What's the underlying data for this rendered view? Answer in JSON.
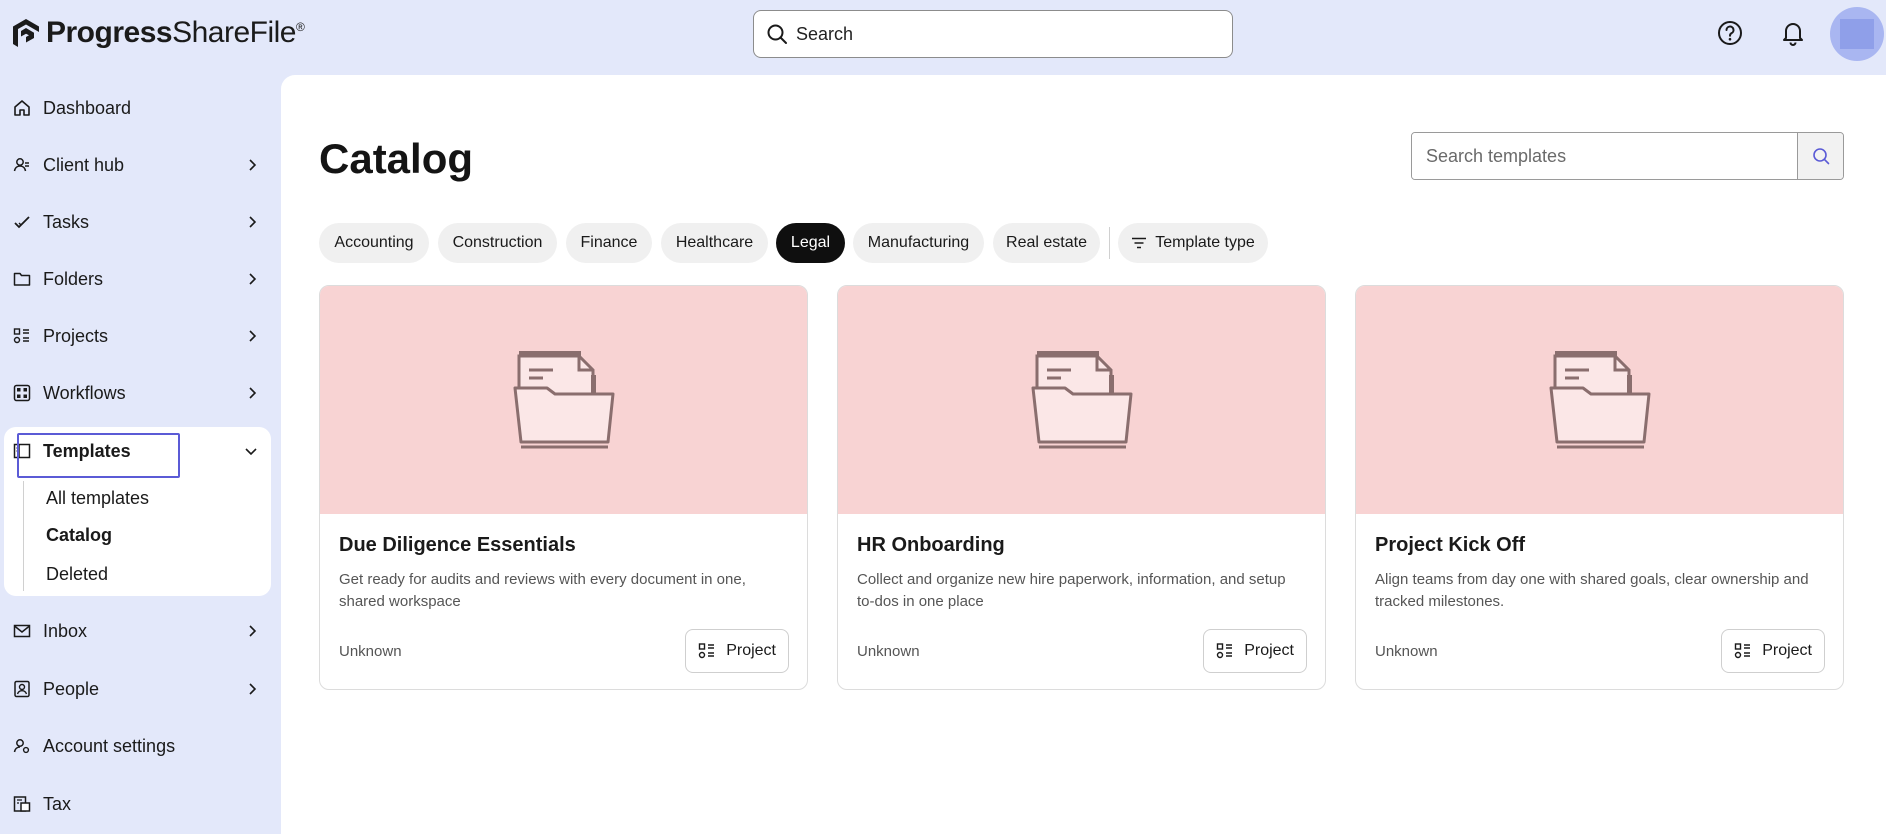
{
  "brand": {
    "name_bold": "Progress",
    "name_light": "ShareFile",
    "mark": "®"
  },
  "header": {
    "search_placeholder": "Search"
  },
  "colors": {
    "accent": "#5b5bd6",
    "background": "#e3e8fa",
    "card_hero": "#f8d3d3",
    "chip_active": "#0f0f0f"
  },
  "sidebar": {
    "items": [
      {
        "label": "Dashboard",
        "icon": "home-icon",
        "chevron": false
      },
      {
        "label": "Client hub",
        "icon": "client-hub-icon",
        "chevron": true
      },
      {
        "label": "Tasks",
        "icon": "checkmark-icon",
        "chevron": true
      },
      {
        "label": "Folders",
        "icon": "folder-icon",
        "chevron": true
      },
      {
        "label": "Projects",
        "icon": "projects-icon",
        "chevron": true
      },
      {
        "label": "Workflows",
        "icon": "workflows-icon",
        "chevron": true
      },
      {
        "label": "Templates",
        "icon": "templates-icon",
        "expanded": true,
        "children": [
          "All templates",
          "Catalog",
          "Deleted"
        ],
        "active_child": "Catalog"
      },
      {
        "label": "Inbox",
        "icon": "inbox-icon",
        "chevron": true
      },
      {
        "label": "People",
        "icon": "people-icon",
        "chevron": true
      },
      {
        "label": "Account settings",
        "icon": "account-settings-icon",
        "chevron": false
      },
      {
        "label": "Tax",
        "icon": "tax-icon",
        "chevron": false
      }
    ]
  },
  "main": {
    "title": "Catalog",
    "search_placeholder": "Search templates",
    "filters": [
      "Accounting",
      "Construction",
      "Finance",
      "Healthcare",
      "Legal",
      "Manufacturing",
      "Real estate"
    ],
    "active_filter": "Legal",
    "type_filter_label": "Template type",
    "cards": [
      {
        "title": "Due Diligence Essentials",
        "description": "Get ready for audits and reviews with every document in one, shared workspace",
        "author": "Unknown",
        "type": "Project"
      },
      {
        "title": "HR Onboarding",
        "description": "Collect and organize new hire paperwork, information, and setup to-dos in one place",
        "author": "Unknown",
        "type": "Project"
      },
      {
        "title": "Project Kick Off",
        "description": "Align teams from day one with shared goals, clear ownership and tracked milestones.",
        "author": "Unknown",
        "type": "Project"
      }
    ]
  }
}
